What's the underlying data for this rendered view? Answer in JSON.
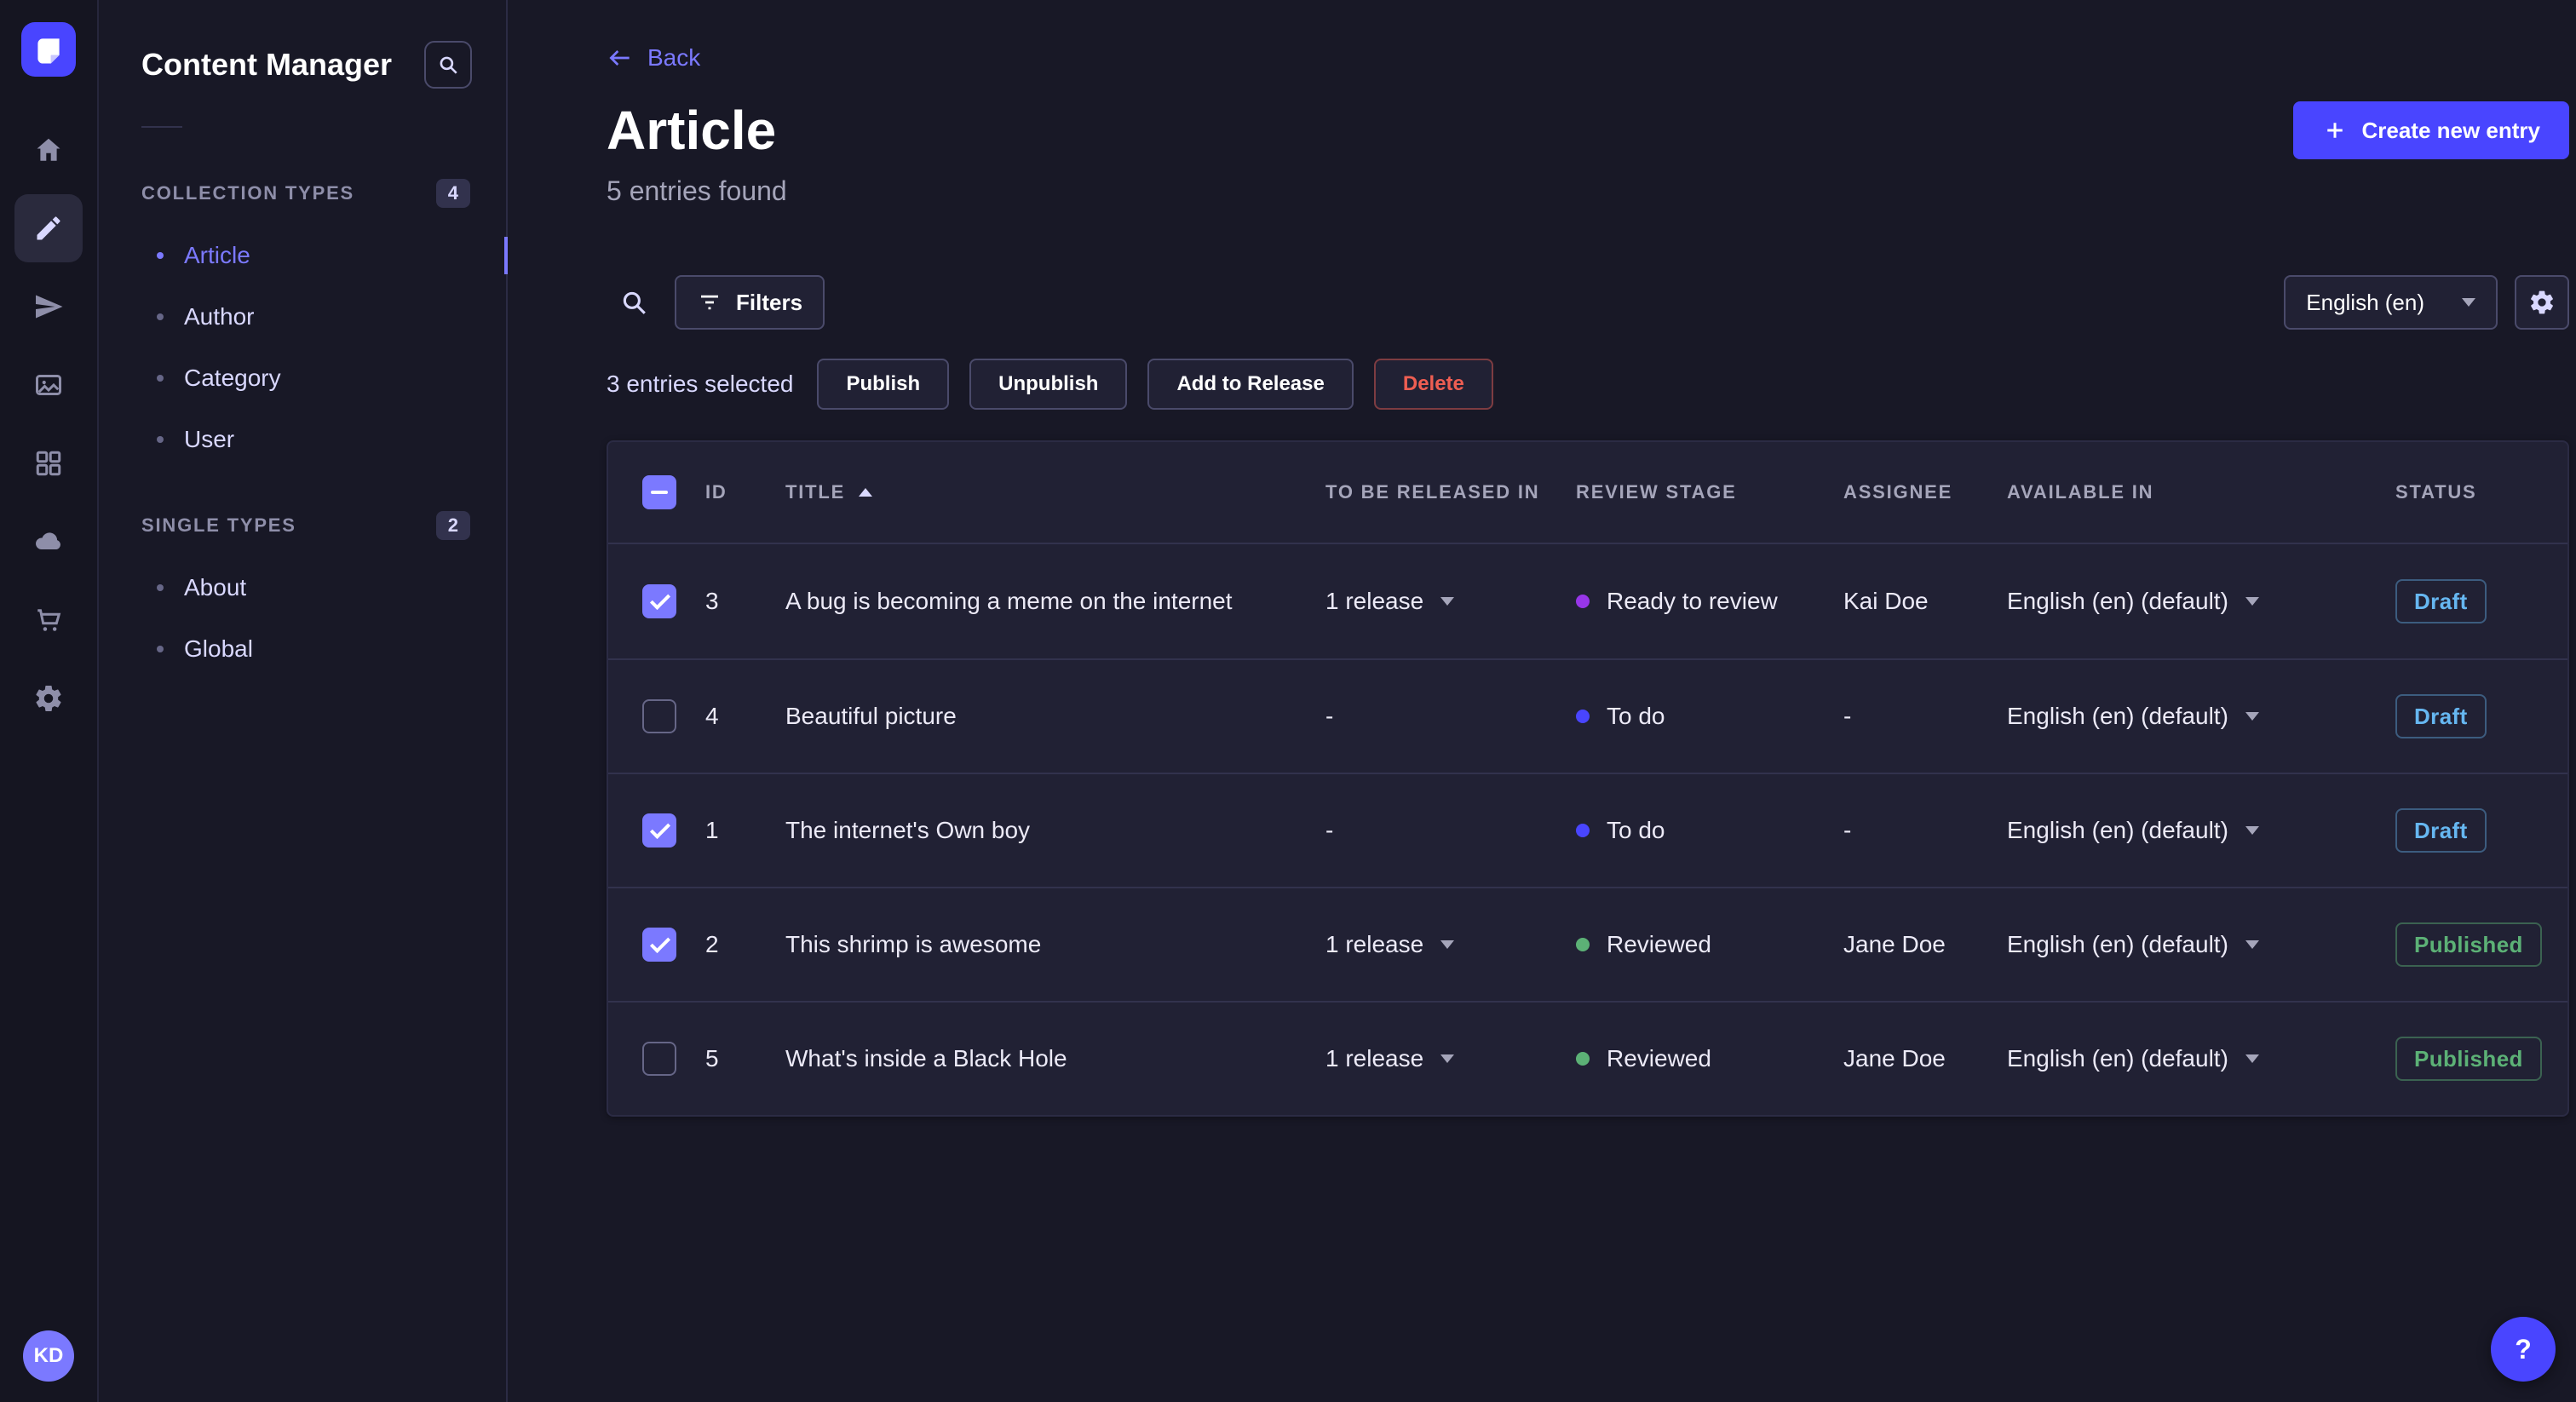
{
  "colors": {
    "accent": "#4945ff",
    "accent_light": "#7b79ff",
    "success": "#5cb176",
    "danger": "#ee5e52",
    "draft_blue": "#66b7f1"
  },
  "main_nav": {
    "logo_icon": "strapi-logo",
    "items": [
      {
        "icon": "home-icon",
        "active": false
      },
      {
        "icon": "content-manager-icon",
        "active": true
      },
      {
        "icon": "releases-icon",
        "active": false
      },
      {
        "icon": "media-library-icon",
        "active": false
      },
      {
        "icon": "content-type-builder-icon",
        "active": false
      },
      {
        "icon": "deploy-icon",
        "active": false
      },
      {
        "icon": "marketplace-icon",
        "active": false
      },
      {
        "icon": "settings-icon",
        "active": false
      }
    ],
    "avatar_initials": "KD"
  },
  "subnav": {
    "title": "Content Manager",
    "search_icon": "search-icon",
    "sections": [
      {
        "label": "COLLECTION TYPES",
        "badge": "4",
        "items": [
          {
            "label": "Article",
            "active": true
          },
          {
            "label": "Author",
            "active": false
          },
          {
            "label": "Category",
            "active": false
          },
          {
            "label": "User",
            "active": false
          }
        ]
      },
      {
        "label": "SINGLE TYPES",
        "badge": "2",
        "items": [
          {
            "label": "About",
            "active": false
          },
          {
            "label": "Global",
            "active": false
          }
        ]
      }
    ]
  },
  "header": {
    "back": "Back",
    "title": "Article",
    "subtitle": "5 entries found",
    "create_button": "Create new entry"
  },
  "toolbar": {
    "filters": "Filters",
    "locale": "English (en)"
  },
  "selection": {
    "count_label": "3 entries selected",
    "publish": "Publish",
    "unpublish": "Unpublish",
    "add_to_release": "Add to Release",
    "delete": "Delete"
  },
  "table": {
    "header_checkbox": "mixed",
    "sort": {
      "column": "TITLE",
      "direction": "asc"
    },
    "headers": {
      "id": "ID",
      "title": "TITLE",
      "release": "TO BE RELEASED IN",
      "stage": "REVIEW STAGE",
      "assignee": "ASSIGNEE",
      "available": "AVAILABLE IN",
      "status": "STATUS"
    },
    "rows": [
      {
        "checked": true,
        "id": "3",
        "title": "A bug is becoming a meme on the internet",
        "release": "1 release",
        "release_menu": true,
        "stage": "Ready to review",
        "stage_color": "#9736e8",
        "assignee": "Kai Doe",
        "available": "English (en) (default)",
        "status": "Draft"
      },
      {
        "checked": false,
        "id": "4",
        "title": "Beautiful picture",
        "release": "-",
        "release_menu": false,
        "stage": "To do",
        "stage_color": "#4945ff",
        "assignee": "-",
        "available": "English (en) (default)",
        "status": "Draft"
      },
      {
        "checked": true,
        "id": "1",
        "title": "The internet's Own boy",
        "release": "-",
        "release_menu": false,
        "stage": "To do",
        "stage_color": "#4945ff",
        "assignee": "-",
        "available": "English (en) (default)",
        "status": "Draft"
      },
      {
        "checked": true,
        "id": "2",
        "title": "This shrimp is awesome",
        "release": "1 release",
        "release_menu": true,
        "stage": "Reviewed",
        "stage_color": "#5cb176",
        "assignee": "Jane Doe",
        "available": "English (en) (default)",
        "status": "Published"
      },
      {
        "checked": false,
        "id": "5",
        "title": "What's inside a Black Hole",
        "release": "1 release",
        "release_menu": true,
        "stage": "Reviewed",
        "stage_color": "#5cb176",
        "assignee": "Jane Doe",
        "available": "English (en) (default)",
        "status": "Published"
      }
    ]
  },
  "help": {
    "label": "?"
  }
}
